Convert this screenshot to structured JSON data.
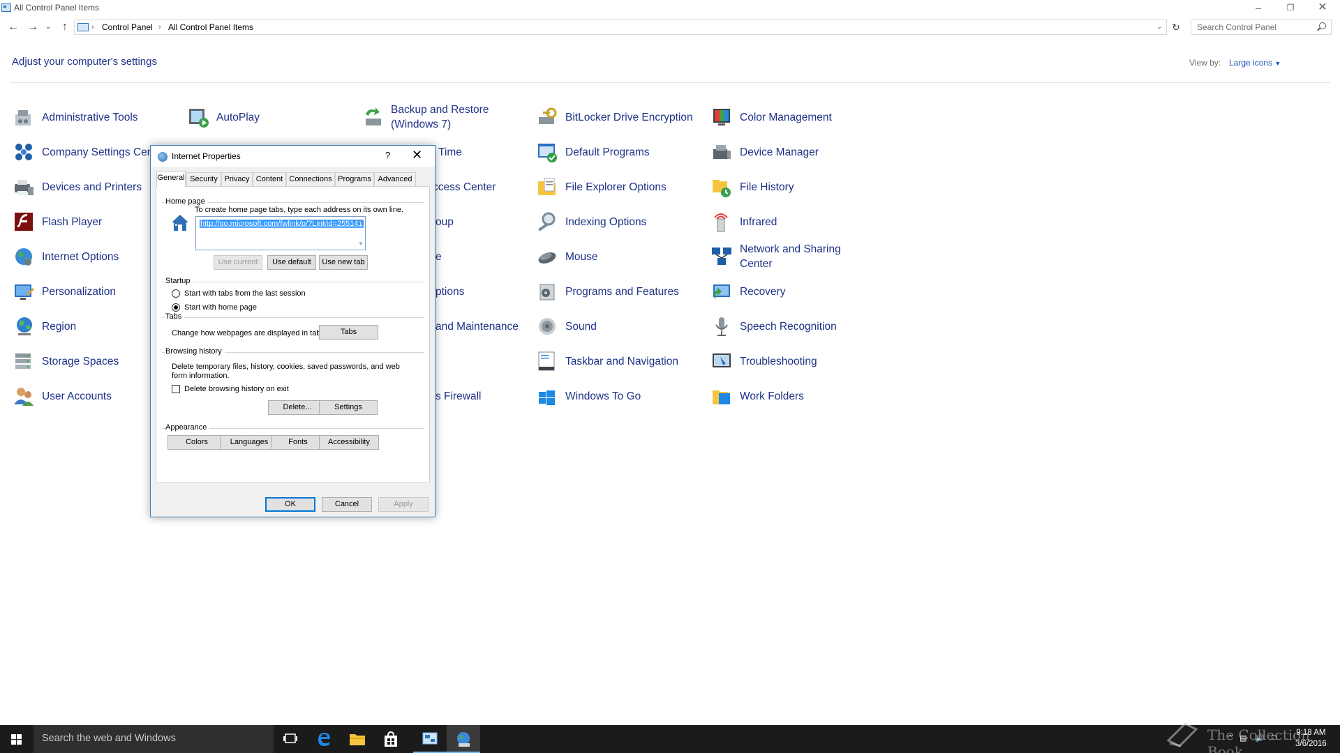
{
  "window": {
    "title": "All Control Panel Items"
  },
  "address": {
    "crumbs": [
      "Control Panel",
      "All Control Panel Items"
    ],
    "search_placeholder": "Search Control Panel"
  },
  "header": {
    "heading": "Adjust your computer's settings",
    "view_by_label": "View by:",
    "view_by_value": "Large icons"
  },
  "items": {
    "c1": [
      "Administrative Tools",
      "Company Settings Center",
      "Devices and Printers",
      "Flash Player",
      "Internet Options",
      "Personalization",
      "Region",
      "Storage Spaces",
      "User Accounts"
    ],
    "c2": [
      "AutoPlay",
      "Time",
      "ccess Center",
      "oup",
      "e",
      "ptions",
      "and Maintenance",
      "",
      "s Firewall"
    ],
    "c3": [
      "Backup and Restore (Windows 7)"
    ],
    "c4": [
      "BitLocker Drive Encryption",
      "Default Programs",
      "File Explorer Options",
      "Indexing Options",
      "Mouse",
      "Programs and Features",
      "Sound",
      "Taskbar and Navigation",
      "Windows To Go"
    ],
    "c5": [
      "Color Management",
      "Device Manager",
      "File History",
      "Infrared",
      "Network and Sharing Center",
      "Recovery",
      "Speech Recognition",
      "Troubleshooting",
      "Work Folders"
    ]
  },
  "dialog": {
    "title": "Internet Properties",
    "help": "?",
    "tabs": [
      "General",
      "Security",
      "Privacy",
      "Content",
      "Connections",
      "Programs",
      "Advanced"
    ],
    "home": {
      "group": "Home page",
      "hint": "To create home page tabs, type each address on its own line.",
      "url": "http://go.microsoft.com/fwlink/p/?LinkId=255141",
      "use_current": "Use current",
      "use_default": "Use default",
      "use_new_tab": "Use new tab"
    },
    "startup": {
      "group": "Startup",
      "option1": "Start with tabs from the last session",
      "option2": "Start with home page"
    },
    "tabs_group": {
      "group": "Tabs",
      "desc": "Change how webpages are displayed in tabs.",
      "button": "Tabs"
    },
    "history": {
      "group": "Browsing history",
      "desc": "Delete temporary files, history, cookies, saved passwords, and web form information.",
      "checkbox": "Delete browsing history on exit",
      "delete": "Delete...",
      "settings": "Settings"
    },
    "appearance": {
      "group": "Appearance",
      "colors": "Colors",
      "languages": "Languages",
      "fonts": "Fonts",
      "accessibility": "Accessibility"
    },
    "ok": "OK",
    "cancel": "Cancel",
    "apply": "Apply"
  },
  "taskbar": {
    "search": "Search the web and Windows",
    "time": "9:18 AM",
    "date": "3/6/2016",
    "watermark": "The Collection Book"
  },
  "colors": {
    "link": "#1e3287",
    "accent": "#0078d7",
    "taskbar": "#1b1b1b"
  }
}
